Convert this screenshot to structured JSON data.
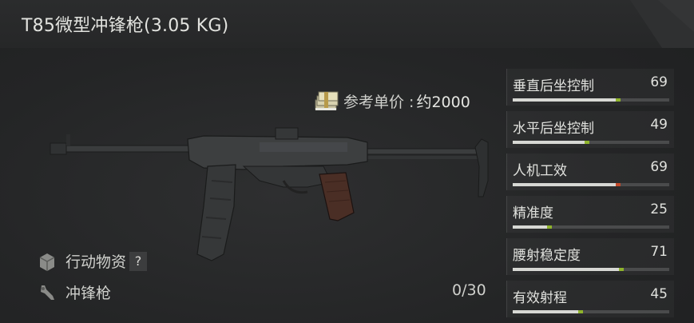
{
  "header": {
    "title": "T85微型冲锋枪(3.05 KG)"
  },
  "price": {
    "label": "参考单价 :",
    "value": "约2000",
    "icon": "cash-stack-icon"
  },
  "weapon": {
    "image": "t85-submachine-gun"
  },
  "meta": {
    "category_label": "行动物资",
    "category_help": "?",
    "type_label": "冲锋枪"
  },
  "ammo": {
    "text": "0/30"
  },
  "stats": [
    {
      "name": "垂直后坐控制",
      "value": "69",
      "level": 0.69,
      "tip": "green"
    },
    {
      "name": "水平后坐控制",
      "value": "49",
      "level": 0.49,
      "tip": "green"
    },
    {
      "name": "人机工效",
      "value": "69",
      "level": 0.69,
      "tip": "red"
    },
    {
      "name": "精准度",
      "value": "25",
      "level": 0.25,
      "tip": "green"
    },
    {
      "name": "腰射稳定度",
      "value": "71",
      "level": 0.71,
      "tip": "green"
    },
    {
      "name": "有效射程",
      "value": "45",
      "level": 0.45,
      "tip": "green"
    }
  ],
  "colors": {
    "accent_green": "#8fb42c",
    "accent_red": "#c24a2a",
    "background": "#232425"
  }
}
